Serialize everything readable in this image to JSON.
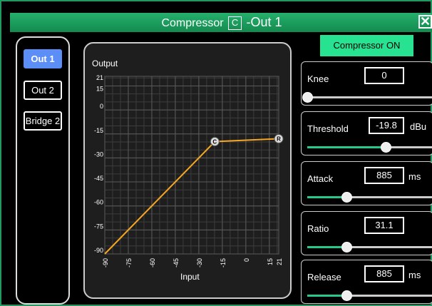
{
  "window": {
    "title_prefix": "Compressor",
    "title_icon": "C",
    "title_suffix": "-Out 1",
    "close_icon": "✕"
  },
  "outputs": [
    {
      "label": "Out 1",
      "active": true
    },
    {
      "label": "Out 2",
      "active": false
    },
    {
      "label": "Bridge 2",
      "active": false
    }
  ],
  "compressor_button": "Compressor ON",
  "graph": {
    "ylabel": "Output",
    "xlabel": "Input",
    "y_ticks": [
      "21",
      "15",
      "0",
      "-15",
      "-30",
      "-45",
      "-60",
      "-75",
      "-90"
    ],
    "x_ticks": [
      "-90",
      "-75",
      "-60",
      "-45",
      "-30",
      "-15",
      "0",
      "15",
      "21"
    ],
    "knee_marker": "C",
    "end_marker": "R",
    "curve_color": "#f5a623"
  },
  "chart_data": {
    "type": "line",
    "xlabel": "Input",
    "ylabel": "Output",
    "xlim": [
      -90,
      21
    ],
    "ylim": [
      -90,
      21
    ],
    "series": [
      {
        "x": [
          -90,
          -19.8,
          21
        ],
        "y": [
          -90,
          -19.8,
          -18
        ]
      }
    ]
  },
  "params": [
    {
      "label": "Knee",
      "value": "0",
      "unit": "",
      "level": 0.0
    },
    {
      "label": "Threshold",
      "value": "-19.8",
      "unit": "dBu",
      "level": 0.62
    },
    {
      "label": "Attack",
      "value": "885",
      "unit": "ms",
      "level": 0.31
    },
    {
      "label": "Ratio",
      "value": "31.1",
      "unit": "",
      "level": 0.31
    },
    {
      "label": "Release",
      "value": "885",
      "unit": "ms",
      "level": 0.31
    }
  ],
  "colors": {
    "accent_green": "#27e290",
    "title_green": "#1f9a60",
    "active_blue": "#5b8ef7",
    "slider_fill": "#27c98a"
  }
}
